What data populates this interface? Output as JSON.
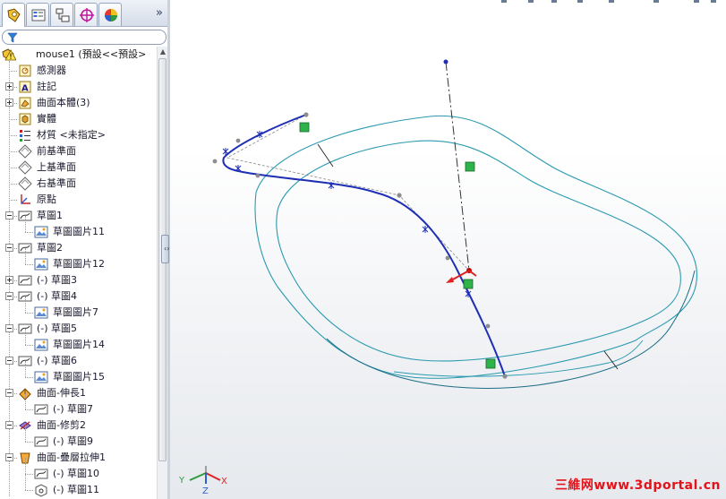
{
  "tabs": [
    {
      "name": "feature-manager-tab",
      "icon": "feature-manager-icon"
    },
    {
      "name": "property-manager-tab",
      "icon": "property-manager-icon"
    },
    {
      "name": "configuration-manager-tab",
      "icon": "configuration-manager-icon"
    },
    {
      "name": "dimxpert-manager-tab",
      "icon": "dimxpert-icon"
    },
    {
      "name": "display-manager-tab",
      "icon": "display-manager-icon"
    }
  ],
  "more_tabs_glyph": "»",
  "tree": {
    "root": {
      "label": "mouse1 (預設<<預設>",
      "icon": "part-warning-icon"
    },
    "items": [
      {
        "label": "感測器",
        "icon": "sensor-icon"
      },
      {
        "label": "註記",
        "icon": "annotation-icon"
      },
      {
        "label": "曲面本體(3)",
        "icon": "surface-bodies-icon"
      },
      {
        "label": "實體",
        "icon": "solid-bodies-icon"
      },
      {
        "label": "材質 <未指定>",
        "icon": "material-icon"
      },
      {
        "label": "前基準面",
        "icon": "plane-icon"
      },
      {
        "label": "上基準面",
        "icon": "plane-icon"
      },
      {
        "label": "右基準面",
        "icon": "plane-icon"
      },
      {
        "label": "原點",
        "icon": "origin-icon"
      },
      {
        "label": "草圖1",
        "icon": "sketch-icon"
      },
      {
        "label": "草圖圖片11",
        "icon": "sketch-picture-icon"
      },
      {
        "label": "草圖2",
        "icon": "sketch-icon"
      },
      {
        "label": "草圖圖片12",
        "icon": "sketch-picture-icon"
      },
      {
        "label": "(-) 草圖3",
        "icon": "sketch-icon"
      },
      {
        "label": "(-) 草圖4",
        "icon": "sketch-icon"
      },
      {
        "label": "草圖圖片7",
        "icon": "sketch-picture-icon"
      },
      {
        "label": "(-) 草圖5",
        "icon": "sketch-icon"
      },
      {
        "label": "草圖圖片14",
        "icon": "sketch-picture-icon"
      },
      {
        "label": "(-) 草圖6",
        "icon": "sketch-icon"
      },
      {
        "label": "草圖圖片15",
        "icon": "sketch-picture-icon"
      },
      {
        "label": "曲面-伸長1",
        "icon": "surface-extrude-icon"
      },
      {
        "label": "(-) 草圖7",
        "icon": "sketch-icon"
      },
      {
        "label": "曲面-修剪2",
        "icon": "surface-trim-icon"
      },
      {
        "label": "(-) 草圖9",
        "icon": "sketch-icon"
      },
      {
        "label": "曲面-疊層拉伸1",
        "icon": "surface-loft-icon"
      },
      {
        "label": "(-) 草圖10",
        "icon": "sketch-icon"
      },
      {
        "label": "(-) 草圖11",
        "icon": "sketch-3d-icon"
      }
    ]
  },
  "triad": {
    "x": "X",
    "y": "Y",
    "z": "Z"
  },
  "watermark": "三維网www.3dportal.cn",
  "colors": {
    "sketch_curve": "#1f2fb5",
    "surface_edge": "#2a9ab0",
    "handle_green": "#2db34a",
    "point_grey": "#8c8c8c",
    "watermark": "#e3131b"
  }
}
